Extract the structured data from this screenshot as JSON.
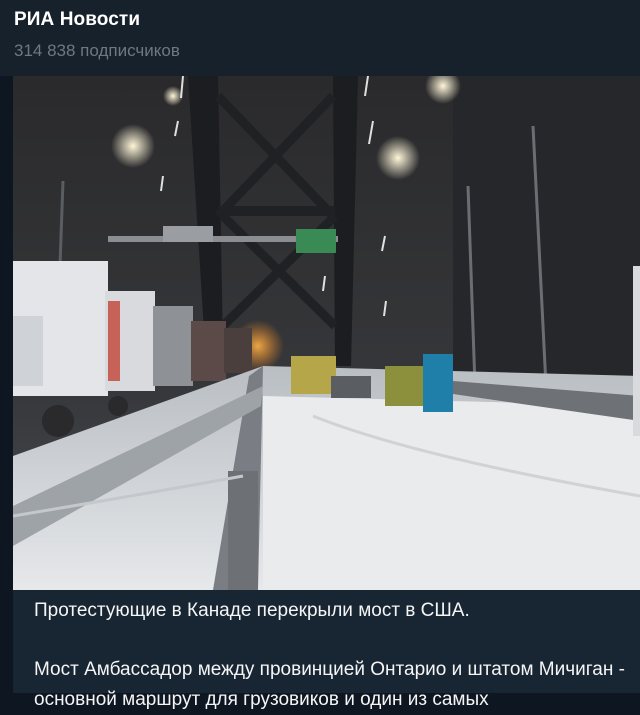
{
  "channel": {
    "name": "РИА Новости",
    "subscribers": "314 838 подписчиков"
  },
  "post": {
    "paragraph1": "Протестующие в Канаде перекрыли мост в США.",
    "paragraph2": "Мост Амбассадор между провинцией Онтарио и штатом Мичиган - основной маршрут для грузовиков и один из самых"
  },
  "colors": {
    "background": "#0e1621",
    "header": "#17212b",
    "post_bubble": "#182533",
    "name_text": "#ffffff",
    "subtitle_text": "#6c7883"
  }
}
